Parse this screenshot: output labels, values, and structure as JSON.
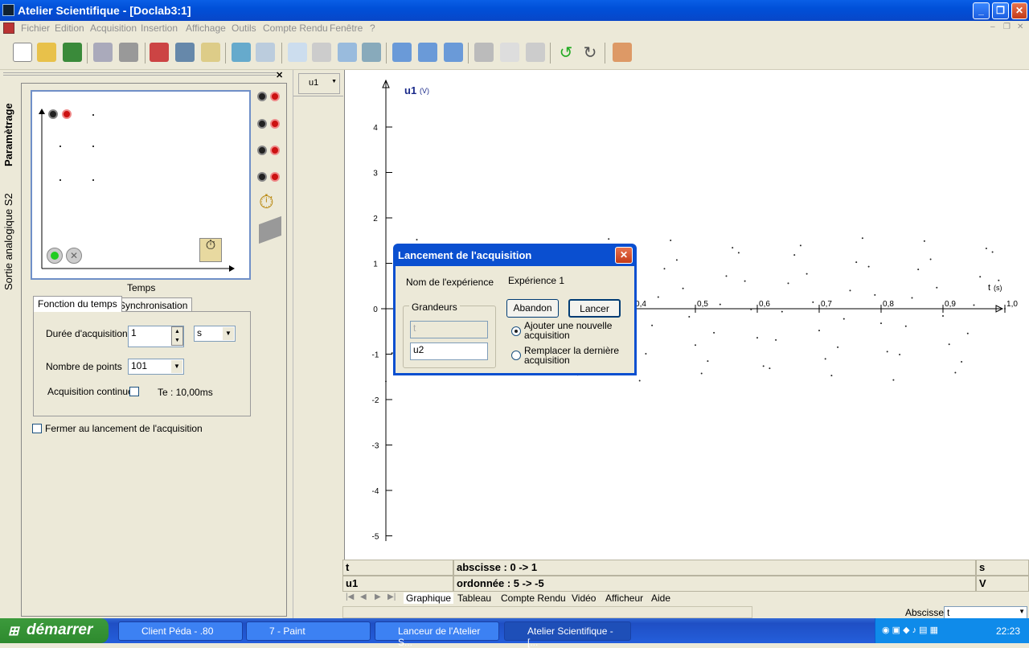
{
  "window": {
    "title": "Atelier Scientifique - [Doclab3:1]"
  },
  "menu": [
    "Fichier",
    "Edition",
    "Acquisition",
    "Insertion",
    "Affichage",
    "Outils",
    "Compte Rendu",
    "Fenêtre",
    "?"
  ],
  "left_tabs": {
    "param": "Paramètrage",
    "sortie": "Sortie analogique S2"
  },
  "schema": {
    "label": "Temps"
  },
  "acq_tabs": {
    "tab1": "Fonction du temps",
    "tab2": "Synchronisation"
  },
  "acq_form": {
    "duree_label": "Durée d'acquisition",
    "duree_value": "1",
    "unit_value": "s",
    "points_label": "Nombre de points",
    "points_value": "101",
    "continue_label": "Acquisition continue",
    "te_label": "Te : 10,00ms"
  },
  "fermer_label": "Fermer au lancement de l'acquisition",
  "variable_select": "u1",
  "graph": {
    "y_name": "u1",
    "y_unit": "(V)",
    "x_name": "t",
    "x_unit": "(s)",
    "y_ticks": [
      "4",
      "3",
      "2",
      "1",
      "0",
      "-1",
      "-2",
      "-3",
      "-4",
      "-5"
    ],
    "x_ticks": [
      "0,4",
      "0,5",
      "0,6",
      "0,7",
      "0,8",
      "0,9",
      "1,0"
    ]
  },
  "chart_data": {
    "type": "scatter",
    "title": "",
    "xlabel": "t (s)",
    "ylabel": "u1 (V)",
    "xlim": [
      0,
      1
    ],
    "ylim": [
      -5,
      4.5
    ],
    "grid": false,
    "series": [
      {
        "name": "u1",
        "values": []
      }
    ]
  },
  "info": {
    "x_var": "t",
    "x_desc": "abscisse : 0 -> 1",
    "x_unit": "s",
    "y_var": "u1",
    "y_desc": "ordonnée : 5 -> -5",
    "y_unit": "V"
  },
  "bottom_tabs": [
    "Graphique",
    "Tableau",
    "Compte Rendu",
    "Vidéo",
    "Afficheur",
    "Aide"
  ],
  "status": {
    "abscisse_label": "Abscisse",
    "abscisse_value": "t"
  },
  "dialog": {
    "title": "Lancement de l'acquisition",
    "nom_label": "Nom de l'expérience",
    "nom_value": "Expérience 1",
    "grandeurs_label": "Grandeurs",
    "g1": "t",
    "g2": "u2",
    "abandon": "Abandon",
    "lancer": "Lancer",
    "opt1": "Ajouter une nouvelle acquisition",
    "opt2": "Remplacer la dernière acquisition"
  },
  "taskbar": {
    "start": "démarrer",
    "tasks": [
      "Client Péda - .80",
      "7 - Paint",
      "Lanceur de l'Atelier S...",
      "Atelier Scientifique - [..."
    ],
    "clock": "22:23"
  },
  "colors": {
    "title_blue": "#0054e3",
    "graph_label": "#1a2a8a"
  }
}
